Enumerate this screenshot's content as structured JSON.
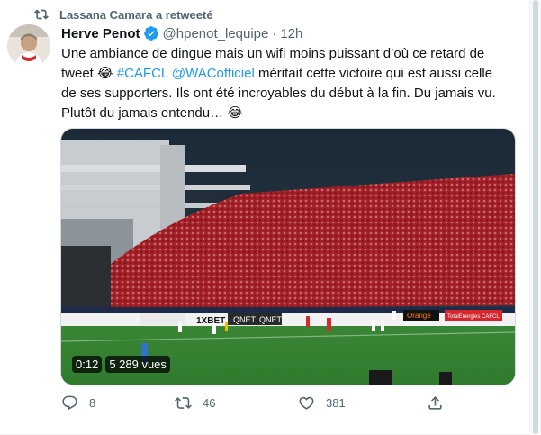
{
  "retweet": {
    "text": "Lassana Camara a retweeté"
  },
  "author": {
    "name": "Herve Penot",
    "handle": "@hpenot_lequipe",
    "time": "12h"
  },
  "tweet": {
    "line1": "Une ambiance de dingue mais un wifi moins puissant d’où ce retard de",
    "line2_a": "tweet ",
    "emoji1": "😂",
    "hashtag": "#CAFCL",
    "mention": "@WACofficiel",
    "line2_b": " méritait cette victoire qui est aussi celle",
    "line3": "de ses supporters. Ils ont été incroyables du début à la fin. Du jamais vu.",
    "line4": "Plutôt du jamais entendu… ",
    "emoji2": "😂"
  },
  "video": {
    "time": "0:12",
    "views": "5 289 vues",
    "board_text": [
      "QNET",
      "QNET",
      "1XBET",
      "Orange",
      "TotalEnergies CAFCL"
    ]
  },
  "actions": {
    "replies": "8",
    "retweets": "46",
    "likes": "381"
  },
  "colors": {
    "accent": "#1d9bf0",
    "muted": "#536471",
    "text": "#0f1419",
    "crowd": "#a8222b",
    "pitch": "#3f8a3a"
  }
}
